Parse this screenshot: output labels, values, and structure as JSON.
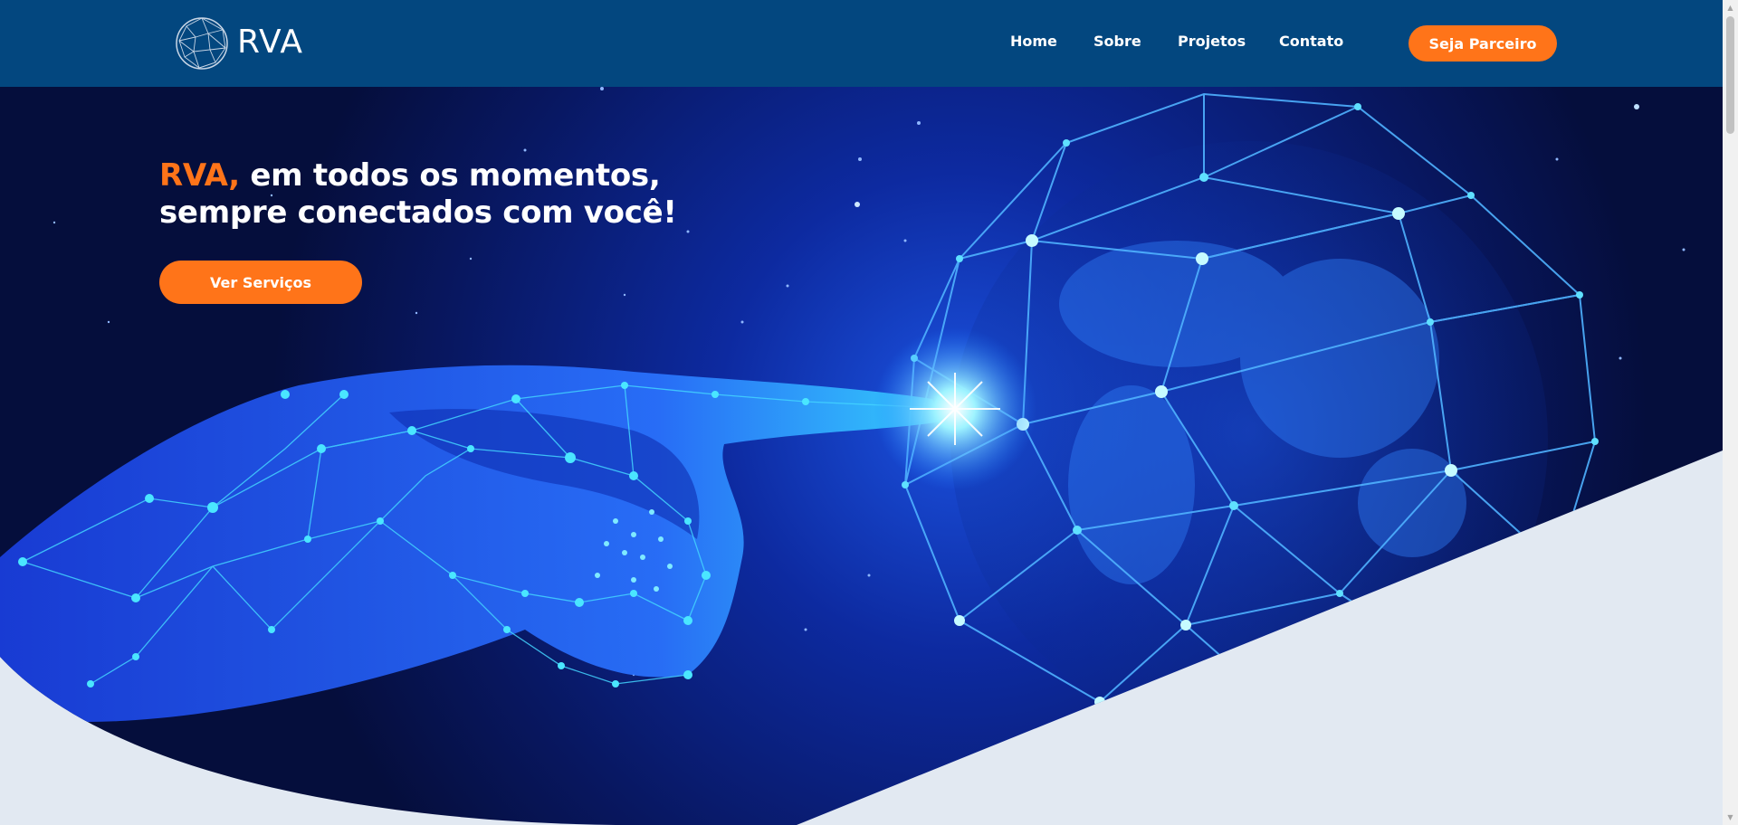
{
  "header": {
    "logo_text": "RVA",
    "nav": [
      "Home",
      "Sobre",
      "Projetos",
      "Contato"
    ],
    "partner_button": "Seja Parceiro"
  },
  "hero": {
    "headline_brand": "RVA,",
    "headline_rest": " em todos os momentos, sempre conectados com você!",
    "services_button": "Ver Serviços"
  },
  "colors": {
    "header_bg": "#03477f",
    "accent": "#ff7419",
    "hero_dark": "#07134a",
    "section_bg": "#e2e9f2"
  },
  "icons": [
    "globe-logo-icon",
    "chevron-up-icon",
    "chevron-down-icon"
  ]
}
